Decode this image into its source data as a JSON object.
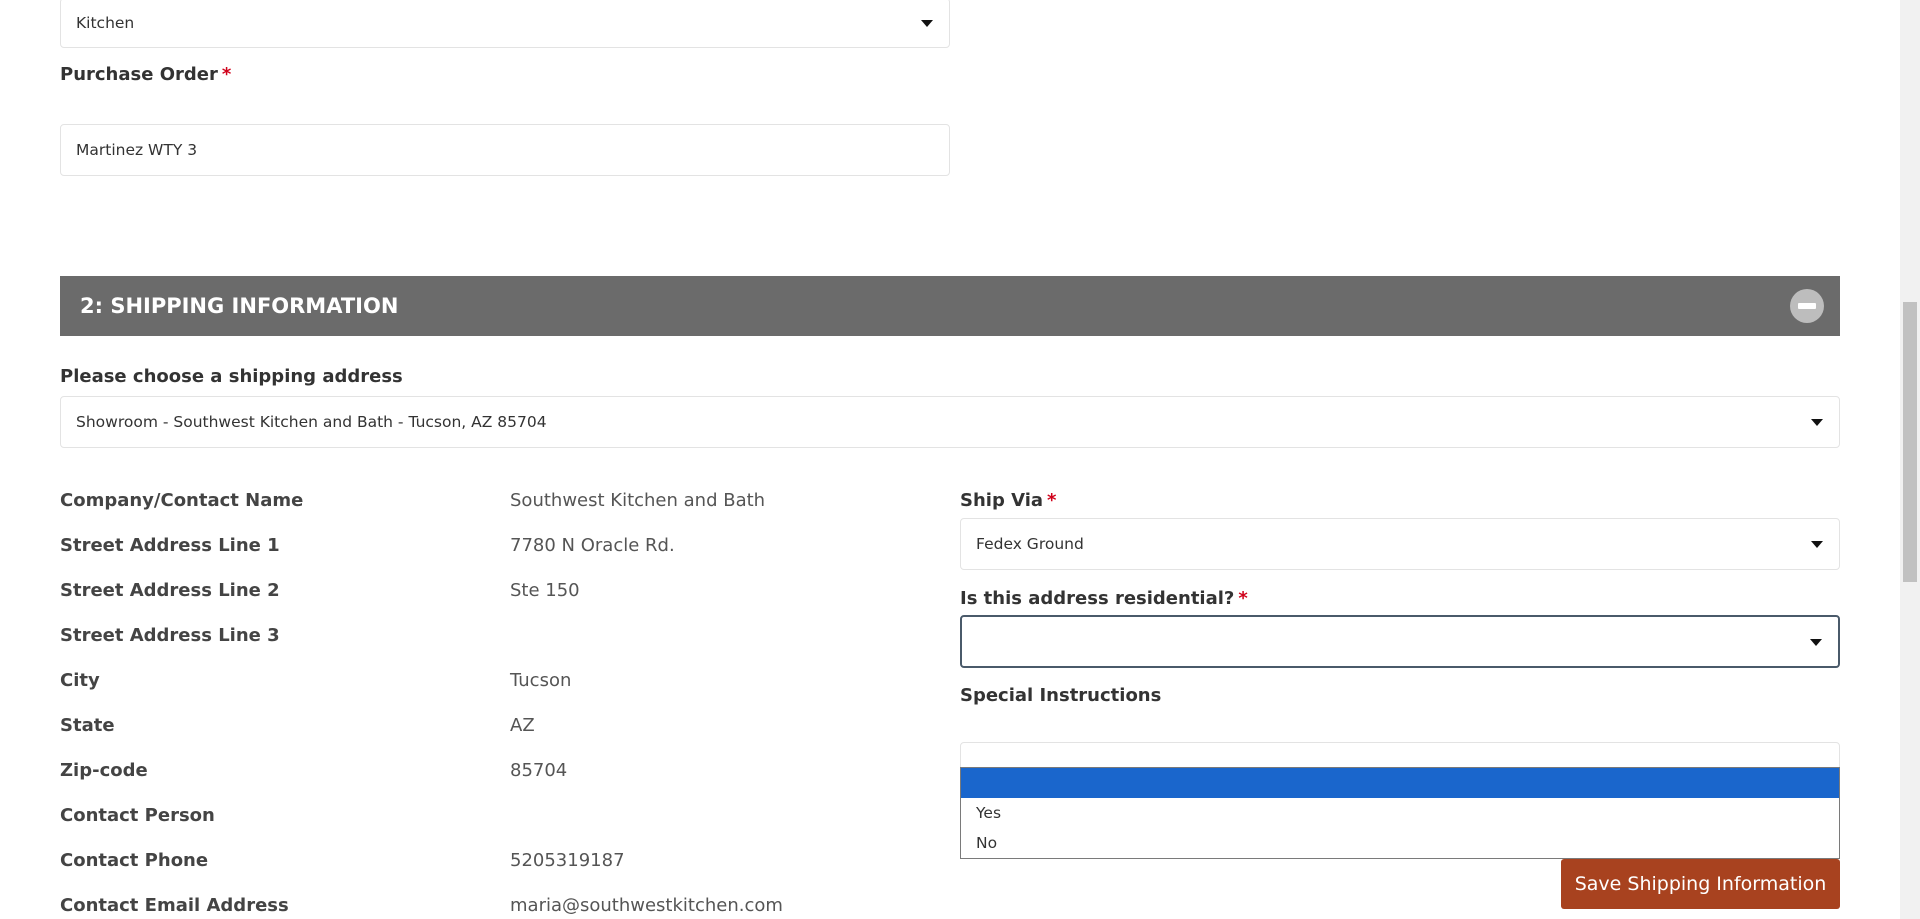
{
  "order": {
    "room_select_value": "Kitchen",
    "purchase_order_label": "Purchase Order",
    "required_mark": "*",
    "purchase_order_value": "Martinez WTY 3"
  },
  "shipping": {
    "section_title": "2: SHIPPING INFORMATION",
    "address_prompt": "Please choose a shipping address",
    "address_select_value": "Showroom - Southwest Kitchen and Bath - Tucson, AZ 85704",
    "details": [
      {
        "label": "Company/Contact Name",
        "value": "Southwest Kitchen and Bath"
      },
      {
        "label": "Street Address Line 1",
        "value": "7780 N Oracle Rd."
      },
      {
        "label": "Street Address Line 2",
        "value": "Ste 150"
      },
      {
        "label": "Street Address Line 3",
        "value": ""
      },
      {
        "label": "City",
        "value": "Tucson"
      },
      {
        "label": "State",
        "value": "AZ"
      },
      {
        "label": "Zip-code",
        "value": "85704"
      },
      {
        "label": "Contact Person",
        "value": ""
      },
      {
        "label": "Contact Phone",
        "value": "5205319187"
      },
      {
        "label": "Contact Email Address",
        "value": "maria@southwestkitchen.com"
      }
    ],
    "ship_via_label": "Ship Via",
    "ship_via_value": "Fedex Ground",
    "residential_label": "Is this address residential?",
    "residential_value": "",
    "residential_options": [
      "",
      "Yes",
      "No"
    ],
    "special_instructions_label": "Special Instructions",
    "save_button": "Save Shipping Information"
  },
  "colors": {
    "section_header_bg": "#6b6b6b",
    "save_button_bg": "#a8421f",
    "selected_option_bg": "#1a66cc",
    "required_color": "#d0021b"
  },
  "icons": {
    "collapse": "minus-circle-icon",
    "select_caret": "caret-down-icon"
  }
}
